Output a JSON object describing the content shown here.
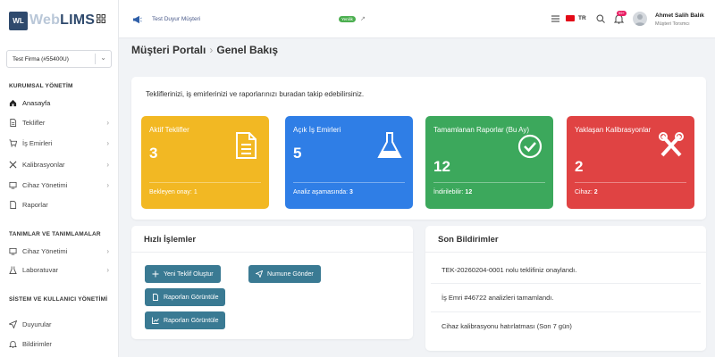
{
  "app": {
    "logo_short": "WL",
    "logo_prefix": "Web",
    "logo_name": "LIMS"
  },
  "sidebar": {
    "company_select": "Test Firma (#55400U)",
    "sections": {
      "corporate": "KURUMSAL YÖNETİM",
      "definitions": "TANIMLAR VE TANIMLAMALAR",
      "system": "SİSTEM VE KULLANICI YÖNETİMİ"
    },
    "items": [
      {
        "label": "Anasayfa",
        "icon": "home-icon",
        "arrow": false
      },
      {
        "label": "Teklifler",
        "icon": "document-icon",
        "arrow": true
      },
      {
        "label": "İş Emirleri",
        "icon": "cart-icon",
        "arrow": true
      },
      {
        "label": "Kalibrasyonlar",
        "icon": "tools-icon",
        "arrow": true
      },
      {
        "label": "Cihaz Yönetimi",
        "icon": "device-icon",
        "arrow": true
      },
      {
        "label": "Raporlar",
        "icon": "report-icon",
        "arrow": false
      },
      {
        "label": "Cihaz Yönetimi",
        "icon": "device-icon",
        "arrow": true
      },
      {
        "label": "Laboratuvar",
        "icon": "lab-icon",
        "arrow": true
      },
      {
        "label": "Duyurular",
        "icon": "send-icon",
        "arrow": false
      },
      {
        "label": "Bildirimler",
        "icon": "bell-icon",
        "arrow": false
      }
    ]
  },
  "topbar": {
    "announcement": "Test Duyur Müşteri",
    "new_badge": "Yenilik",
    "language": "TR",
    "notification_badge": "99+",
    "user_name": "Ahmet Salih Balık",
    "user_role": "Müşteri Torsmcı"
  },
  "page": {
    "breadcrumb_root": "Müşteri Portalı",
    "breadcrumb_current": "Genel Bakış",
    "welcome": "Tekliflerinizi, iş emirlerinizi ve raporlarınızı buradan takip edebilirsiniz."
  },
  "cards": [
    {
      "title": "Aktif Teklifler",
      "value": "3",
      "footer_label": "Bekleyen onay:",
      "footer_value": "1",
      "color": "#f2b823",
      "icon": "document-icon"
    },
    {
      "title": "Açık İş Emirleri",
      "value": "5",
      "footer_label": "Analiz aşamasında:",
      "footer_value": "3",
      "color": "#2f7ee6",
      "icon": "flask-icon"
    },
    {
      "title": "Tamamlanan Raporlar (Bu Ay)",
      "value": "12",
      "footer_label": "İndirilebilir:",
      "footer_value": "12",
      "color": "#3ca85c",
      "icon": "check-circle-icon"
    },
    {
      "title": "Yaklaşan Kalibrasyonlar",
      "value": "2",
      "footer_label": "Cihaz:",
      "footer_value": "2",
      "color": "#e04343",
      "icon": "tools-icon"
    }
  ],
  "quick_actions": {
    "title": "Hızlı İşlemler",
    "buttons": [
      {
        "label": "Yeni Teklif Oluştur",
        "icon": "plus-icon"
      },
      {
        "label": "Numune Gönder",
        "icon": "send-icon"
      },
      {
        "label": "Raporları Görüntüle",
        "icon": "document-icon"
      },
      {
        "label": "Raporları Görüntüle",
        "icon": "chart-icon"
      }
    ]
  },
  "notifications": {
    "title": "Son Bildirimler",
    "items": [
      "TEK-20260204-0001 nolu teklifiniz onaylandı.",
      "İş Emri #46722 analizleri tamamlandı.",
      "Cihaz kalibrasyonu hatırlatması (Son 7 gün)"
    ]
  }
}
